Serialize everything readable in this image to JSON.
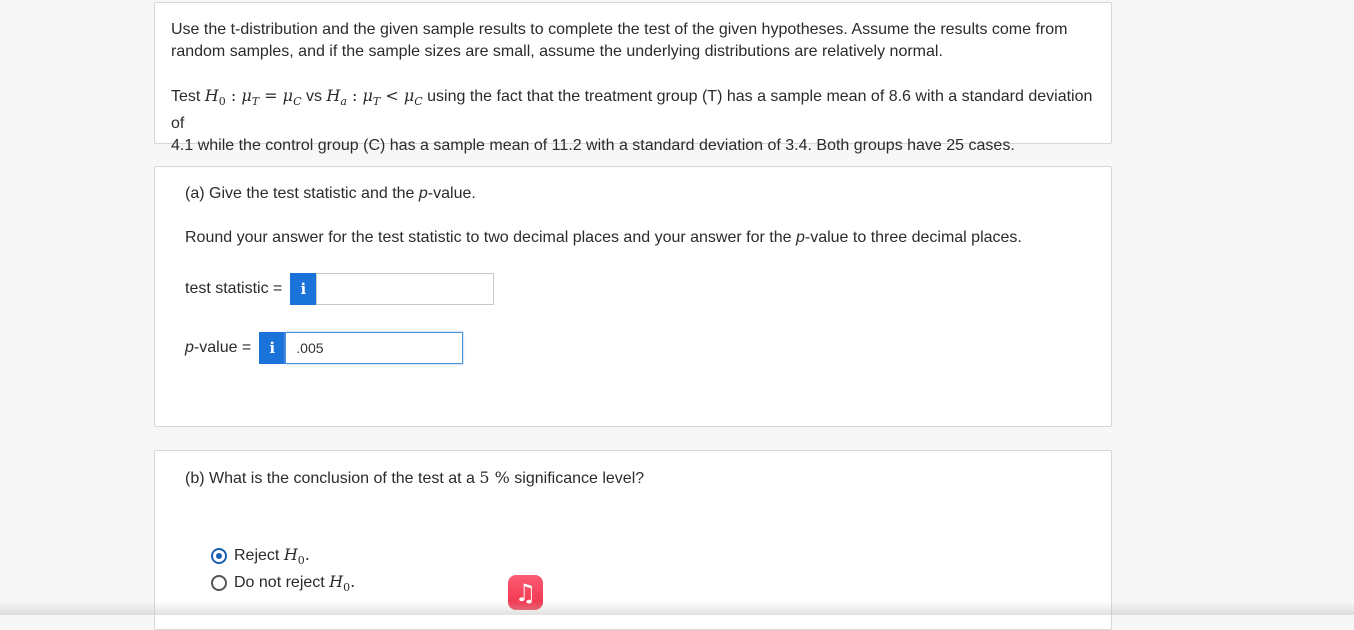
{
  "intro": {
    "line1": "Use the t-distribution and the given sample results to complete the test of the given hypotheses. Assume the results come from",
    "line2": "random samples, and if the sample sizes are small, assume the underlying distributions are relatively normal.",
    "test_prefix": "Test",
    "h0_symbol": "H",
    "h0_sub": "0",
    "mu": "μ",
    "sub_T": "T",
    "sub_C": "C",
    "eq": "=",
    "vs": "vs",
    "ha_symbol": "H",
    "ha_sub": "a",
    "lt": "<",
    "test_rest": "using the fact that the treatment group (T) has a sample mean of 8.6 with a standard deviation of",
    "line4": "4.1 while the control group (C) has a sample mean of 11.2 with a standard deviation of 3.4. Both groups have 25 cases."
  },
  "part_a": {
    "prompt_pre": "(a) Give the test statistic and the ",
    "prompt_p": "p",
    "prompt_post": "-value.",
    "round_pre": "Round your answer for the test statistic to two decimal places and your answer for the ",
    "round_p": "p",
    "round_post": "-value to three decimal places.",
    "test_statistic_label": "test statistic =",
    "info_glyph": "i",
    "test_statistic_value": "",
    "p_value_label_p": "p",
    "p_value_label_rest": "-value =",
    "p_value_value": ".005"
  },
  "part_b": {
    "prompt_pre": "(b) What is the conclusion of the test at a",
    "prompt_num": "5 %",
    "prompt_post": "significance level?",
    "options": [
      {
        "label": "Reject",
        "symbol": "H",
        "sub": "0",
        "checked": true
      },
      {
        "label": "Do not reject",
        "symbol": "H",
        "sub": "0",
        "checked": false
      }
    ]
  },
  "dock": {
    "music_icon": "music-icon",
    "music_glyph": "♫",
    "music_color": "#f0304a"
  }
}
